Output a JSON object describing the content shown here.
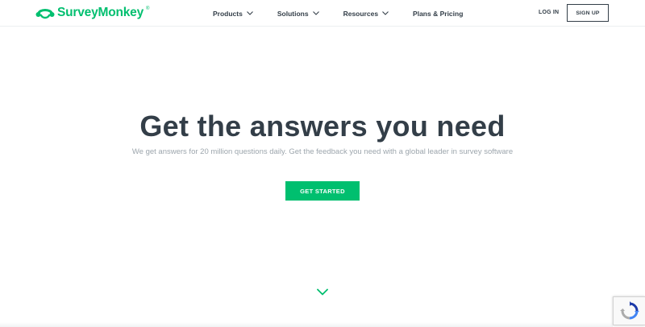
{
  "header": {
    "logo_text": "SurveyMonkey",
    "logo_trademark": "®",
    "nav": [
      {
        "label": "Products",
        "icon": "chevron-down-icon"
      },
      {
        "label": "Solutions",
        "icon": "chevron-down-icon"
      },
      {
        "label": "Resources",
        "icon": "chevron-down-icon"
      },
      {
        "label": "Plans & Pricing"
      }
    ],
    "login_label": "LOG IN",
    "signup_label": "SIGN UP"
  },
  "hero": {
    "title": "Get the answers you need",
    "subtitle": "We get answers for 20 million questions daily. Get the feedback you need with a global leader in survey software",
    "cta_label": "GET STARTED"
  },
  "icons": {
    "scroll": "chevron-down-icon",
    "recaptcha": "recaptcha-icon"
  },
  "colors": {
    "brand_green": "#00bf6f",
    "text_dark": "#333e48",
    "text_muted": "#9da6ad"
  }
}
